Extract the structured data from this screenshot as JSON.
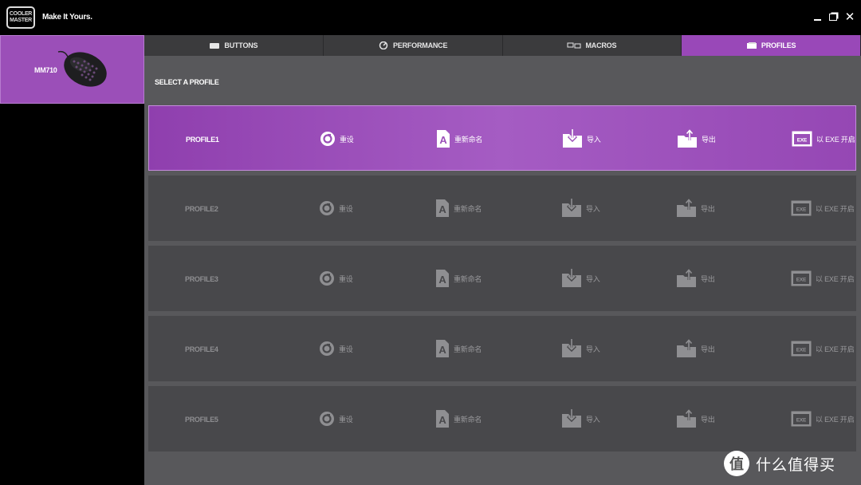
{
  "app": {
    "logo_text": [
      "COOLER",
      "MASTER"
    ],
    "tagline": "Make It Yours.",
    "window_controls": {
      "close": "✕"
    }
  },
  "device": {
    "name": "MM710"
  },
  "tabs": [
    {
      "label": "BUTTONS",
      "icon": "keyboard-icon",
      "active": false
    },
    {
      "label": "PERFORMANCE",
      "icon": "gauge-icon",
      "active": false
    },
    {
      "label": "MACROS",
      "icon": "macro-icon",
      "active": false
    },
    {
      "label": "PROFILES",
      "icon": "profile-folder-icon",
      "active": true
    }
  ],
  "section_title": "SELECT A PROFILE",
  "actions": {
    "reset": "重设",
    "rename": "重新命名",
    "import": "导入",
    "export": "导出",
    "exe": "以 EXE 开启",
    "exe_badge": "EXE"
  },
  "profiles": [
    {
      "name": "PROFILE1",
      "active": true
    },
    {
      "name": "PROFILE2",
      "active": false
    },
    {
      "name": "PROFILE3",
      "active": false
    },
    {
      "name": "PROFILE4",
      "active": false
    },
    {
      "name": "PROFILE5",
      "active": false
    }
  ],
  "colors": {
    "accent": "#9b4fb8",
    "panel_bg": "#58585b",
    "row_bg": "#48484b",
    "inactive_text": "#9a9a9d"
  },
  "watermark": {
    "badge": "值",
    "text": "什么值得买"
  }
}
